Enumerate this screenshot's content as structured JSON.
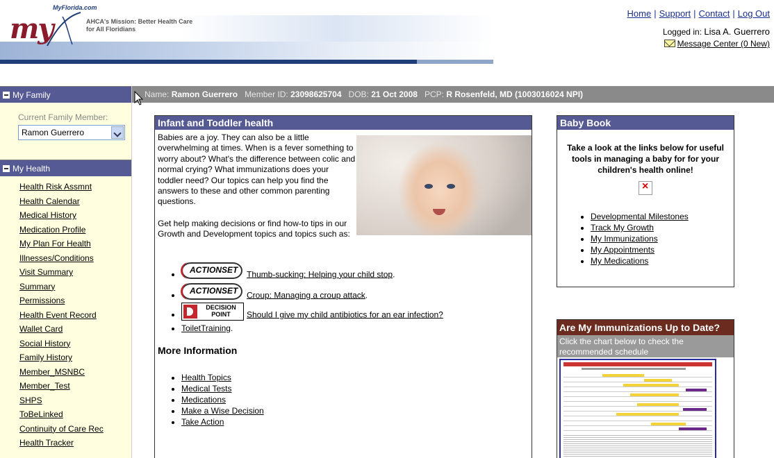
{
  "header": {
    "brand": "MyFlorida.com",
    "logo_text": "my",
    "mission": "AHCA's Mission: Better Health Care for All Floridians",
    "nav": [
      "Home",
      "Support",
      "Contact",
      "Log Out"
    ],
    "logged_in_label": "Logged in:",
    "logged_in_user": "Lisa A. Guerrero",
    "message_center": "Message Center (0 New)"
  },
  "sidebar": {
    "family_header": "My Family",
    "current_member_label": "Current Family Member:",
    "current_member_value": "Ramon Guerrero",
    "health_header": "My Health",
    "health_items": [
      "Health Risk Assmnt",
      "Health Calendar",
      "Medical History",
      "Medication Profile",
      "My Plan For Health",
      "Illnesses/Conditions",
      "Visit Summary",
      "Summary",
      "Permissions",
      "Health Event Record",
      "Wallet Card",
      "Social History",
      "Family History",
      "Member_MSNBC",
      "Member_Test",
      "SHPS",
      "ToBeLinked",
      "Continuity of Care Rec",
      "Health Tracker"
    ]
  },
  "member_bar": {
    "name_label": "Name:",
    "name": "Ramon Guerrero",
    "id_label": "Member ID:",
    "id": "23098625704",
    "dob_label": "DOB:",
    "dob": "21 Oct 2008",
    "pcp_label": "PCP:",
    "pcp": "R Rosenfeld, MD (1003016024 NPI)"
  },
  "infant": {
    "title": "Infant and Toddler health",
    "intro": "Babies are a joy. They can also be a little overwhelming at times. When is a fever something to worry about? What's the difference between colic and normal crying? What immunizations does your toddler need? Our topics can help you find the answers to these and other common parenting questions.",
    "help": "Get help making decisions or find how-to tips in our Growth and Development topics and topics such as:",
    "actionset_label": "ACTIONSET",
    "decision_label_1": "DECISION",
    "decision_label_2": "POINT",
    "topics": [
      "Thumb-sucking: Helping your child stop",
      "Croup: Managing a croup attack",
      "Should I give my child antibiotics for an ear infection?",
      "ToiletTraining"
    ],
    "more_title": "More Information",
    "more_links": [
      "Health Topics",
      "Medical Tests",
      "Medications",
      "Make a Wise Decision",
      "Take Action"
    ]
  },
  "babybook": {
    "title": "Baby Book",
    "text": "Take a look at the links below for useful tools in managing a baby for for your children's health online!",
    "links": [
      "Developmental Milestones",
      "Track My Growth",
      "My Immunizations",
      "My Appointments",
      "My Medications"
    ]
  },
  "immunization": {
    "title": "Are My Immunizations Up to Date?",
    "subtitle": "Click the chart below to check the recommended schedule"
  },
  "colors": {
    "panel_header": "#555994",
    "member_bar": "#8a8a8a",
    "immunization_header": "#6b2b1e",
    "sidebar_bg": "#ffffe0",
    "link_nav": "#1a2f8a"
  }
}
